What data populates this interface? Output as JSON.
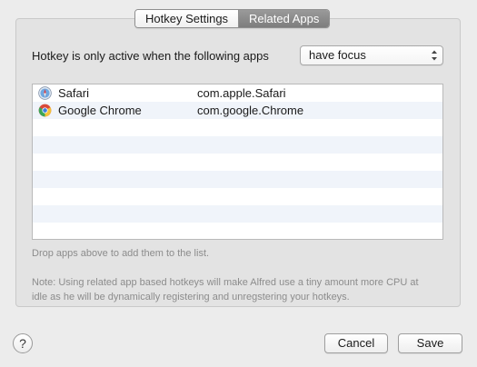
{
  "tabs": {
    "hotkey_settings": "Hotkey Settings",
    "related_apps": "Related Apps",
    "selected": "Related Apps"
  },
  "focus_rule": {
    "label": "Hotkey is only active when the following apps",
    "selected_option": "have focus"
  },
  "apps": [
    {
      "name": "Safari",
      "bundle_id": "com.apple.Safari",
      "icon": "safari-icon"
    },
    {
      "name": "Google Chrome",
      "bundle_id": "com.google.Chrome",
      "icon": "chrome-icon"
    }
  ],
  "hint": "Drop apps above to add them to the list.",
  "note": "Note: Using related app based hotkeys will make Alfred use a tiny amount more CPU at idle as he will be dynamically registering and unregstering your hotkeys.",
  "buttons": {
    "help": "?",
    "cancel": "Cancel",
    "save": "Save"
  },
  "colors": {
    "window_bg": "#ececec",
    "selected_segment": "#8a8a8a",
    "alt_row": "#f0f4fa"
  }
}
